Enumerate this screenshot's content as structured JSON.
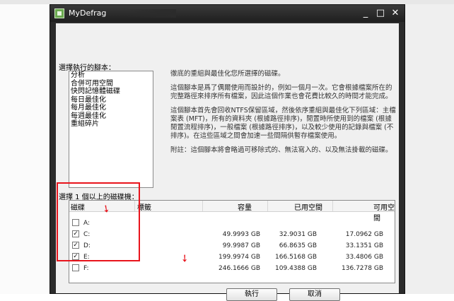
{
  "window": {
    "title": "MyDefrag",
    "minimize_glyph": "_",
    "maximize_glyph": "□",
    "close_glyph": "✕"
  },
  "scripts": {
    "label": "選擇執行的腳本：",
    "items": [
      "分析",
      "合併可用空間",
      "快閃記憶體磁碟",
      "每日最佳化",
      "每月最佳化",
      "每週最佳化",
      "重組碎片"
    ]
  },
  "description": {
    "p1": "徹底的重組與最佳化您所選擇的磁碟。",
    "p2": "這個腳本是爲了偶爾使用而設計的，例如一個月一次。它會根據檔案所在的完整路徑來排序所有檔案，因此這個作業也會花費比較久的時間才能完成。",
    "p3": "這個腳本首先會回收NTFS保留區域，然後依序重組與最佳化下列區域：主檔案表 (MFT)，所有的資料夾 (根據路徑排序)，閒置時所使用到的檔案 (根據閒置流程排序)，一般檔案 (根據路徑排序)，以及較少使用的記錄與檔案 (不排序)。在這些區域之間會加速一些間隔供暫存檔案使用。",
    "p4": "附註：這個腳本將會略過可移除式的、無法寫入的、以及無法掛載的磁碟。"
  },
  "drives": {
    "label": "選擇 1 個以上的磁碟機：",
    "headers": {
      "disk": "磁碟",
      "label": "標籤",
      "capacity": "容量",
      "used": "已用空間",
      "free": "可用空間"
    },
    "rows": [
      {
        "drive": "A:",
        "checked": false,
        "check_glyph": "",
        "capacity": "",
        "used": "",
        "free": ""
      },
      {
        "drive": "C:",
        "checked": true,
        "check_glyph": "✓",
        "capacity": "49.9993 GB",
        "used": "32.9031 GB",
        "free": "17.0962 GB"
      },
      {
        "drive": "D:",
        "checked": true,
        "check_glyph": "✓",
        "capacity": "99.9987 GB",
        "used": "66.8635 GB",
        "free": "33.1351 GB"
      },
      {
        "drive": "E:",
        "checked": true,
        "check_glyph": "✓",
        "capacity": "199.9974 GB",
        "used": "166.5168 GB",
        "free": "33.4806 GB"
      },
      {
        "drive": "F:",
        "checked": false,
        "check_glyph": "",
        "capacity": "246.1666 GB",
        "used": "109.4388 GB",
        "free": "136.7278 GB"
      }
    ]
  },
  "buttons": {
    "run": "執行",
    "cancel": "取消"
  },
  "annotation": {
    "color": "#e8141c",
    "arrow_glyph": "➘"
  }
}
